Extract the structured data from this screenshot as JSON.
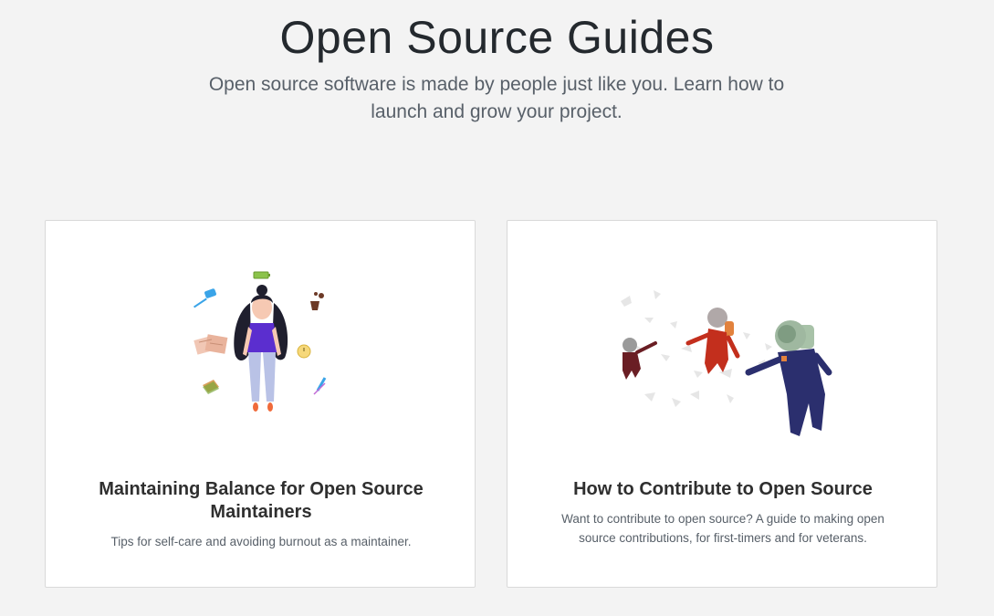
{
  "hero": {
    "title": "Open Source Guides",
    "subtitle": "Open source software is made by people just like you. Learn how to launch and grow your project."
  },
  "cards": [
    {
      "title": "Maintaining Balance for Open Source Maintainers",
      "description": "Tips for self-care and avoiding burnout as a maintainer.",
      "illustration": "woman-with-floating-items-illustration"
    },
    {
      "title": "How to Contribute to Open Source",
      "description": "Want to contribute to open source? A guide to making open source contributions, for first-timers and for veterans.",
      "illustration": "floating-astronauts-illustration"
    }
  ],
  "colors": {
    "background": "#f3f3f3",
    "card": "#ffffff",
    "title": "#24292e",
    "muted": "#586069"
  }
}
